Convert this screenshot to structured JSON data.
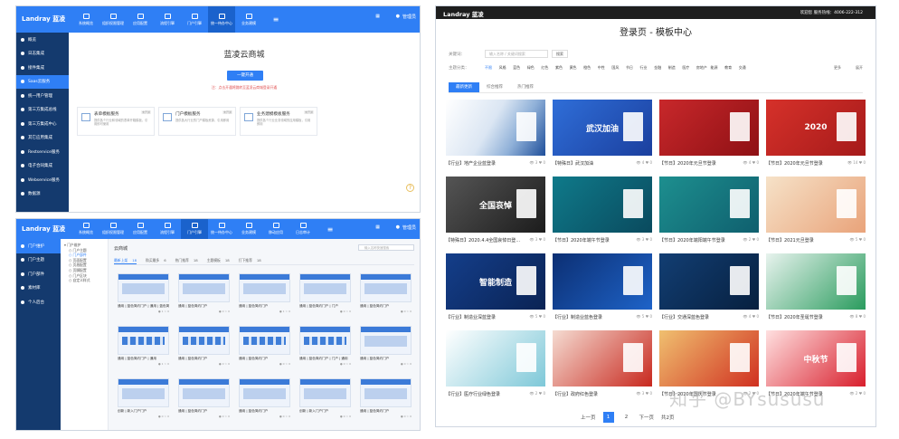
{
  "colors": {
    "primary": "#2f7ff5",
    "sidebar": "#143a6e",
    "dark_bar": "#1e1e1e"
  },
  "pane1": {
    "brand": "Landray 蓝凌",
    "nav": [
      {
        "label": "系统概览",
        "icon": "monitor-icon"
      },
      {
        "label": "组织权限管理",
        "icon": "grid-icon"
      },
      {
        "label": "应用配置",
        "icon": "apps-icon"
      },
      {
        "label": "流程引擎",
        "icon": "gear-icon"
      },
      {
        "label": "门户引擎",
        "icon": "home-icon"
      },
      {
        "label": "统一待办中心",
        "icon": "layers-icon"
      },
      {
        "label": "业务建模",
        "icon": "model-icon"
      }
    ],
    "nav_active": 5,
    "user": "管理员",
    "sidebar": [
      "概览",
      "日志集成",
      "接件集成",
      "Saas云服务",
      "统一用户管理",
      "第三方集成总线",
      "第三方集成中心",
      "其它应用集成",
      "Restservice服务",
      "电子合同集成",
      "Webservice服务",
      "数据源"
    ],
    "sidebar_active": 3,
    "store_title": "蓝凌云商城",
    "activate": "一键开通",
    "note": "注：点击开通将跳转至蓝凌云商城登录开通",
    "cards": [
      {
        "name": "表单模板服务",
        "desc": "提供各个行业和领域的表单开箱模板，引用即可使用",
        "badge": "未开通"
      },
      {
        "name": "门户模板服务",
        "desc": "提供各大行业的门户模板资源，引用即用",
        "badge": "未开通"
      },
      {
        "name": "业务建模模板服务",
        "desc": "提供各个行业业务领域的应用模板，引用即用",
        "badge": "未开通"
      }
    ]
  },
  "pane2": {
    "brand": "Landray 蓝凌",
    "nav": [
      {
        "label": "系统概览",
        "icon": "monitor-icon"
      },
      {
        "label": "组织权限管理",
        "icon": "grid-icon"
      },
      {
        "label": "应用配置",
        "icon": "apps-icon"
      },
      {
        "label": "流程引擎",
        "icon": "gear-icon"
      },
      {
        "label": "门户引擎",
        "icon": "home-icon"
      },
      {
        "label": "统一待办中心",
        "icon": "layers-icon"
      },
      {
        "label": "业务建模",
        "icon": "model-icon"
      },
      {
        "label": "移动应用",
        "icon": "mobile-icon"
      },
      {
        "label": "日志审计",
        "icon": "eye-icon"
      }
    ],
    "nav_active": 4,
    "user": "管理员",
    "sidebar": [
      "门户维护",
      "门户主题",
      "门户部件",
      "素材库",
      "个人后台"
    ],
    "sidebar_active": 0,
    "tree": [
      "门户维护",
      "门户主题",
      "门户部件",
      "页面配置",
      "页眉配置",
      "页脚配置",
      "门户区块",
      "自定义样式"
    ],
    "tree_selected": 2,
    "title": "云商城",
    "search_placeholder": "输入名称快速搜索",
    "tabs": [
      {
        "label": "最新上架",
        "count": "18",
        "active": true
      },
      {
        "label": "购买最多",
        "count": "6"
      },
      {
        "label": "热门推荐",
        "count": "18"
      },
      {
        "label": "主题模板",
        "count": "18"
      },
      {
        "label": "打下推荐",
        "count": "18"
      }
    ],
    "templates": [
      {
        "caption": "通用 | 蓝色简约门户 | 通用 | 蓝色简约门户",
        "stats": "● 1 ☆ 0"
      },
      {
        "caption": "通用 | 蓝色简约门户",
        "stats": "● 0 ☆ 0"
      },
      {
        "caption": "通用 | 蓝色简约门户",
        "stats": "● 1 ☆ 0"
      },
      {
        "caption": "通用 | 蓝色简约门户 | 门户",
        "stats": "● 0 ☆ 0"
      },
      {
        "caption": "通用 | 蓝色简约门户",
        "stats": "● 0 ☆ 0"
      },
      {
        "caption": "通用 | 蓝色简约门户 | 通用",
        "stats": "● 1 ☆ 0"
      },
      {
        "caption": "通用 | 蓝色简约门户",
        "stats": "● 0 ☆ 0"
      },
      {
        "caption": "通用 | 蓝色简约门户",
        "stats": "● 0 ☆ 0"
      },
      {
        "caption": "通用 | 蓝色简约门户 | 门户 | 通用",
        "stats": "● 0 ☆ 0"
      },
      {
        "caption": "通用 | 蓝色简约门户",
        "stats": "● 0 ☆ 0"
      },
      {
        "caption": "创新 | 新入门户门户",
        "stats": "● 0 ☆ 0"
      },
      {
        "caption": "通用 | 蓝色简约门户",
        "stats": "● 0 ☆ 0"
      },
      {
        "caption": "通用 | 蓝色简约门户",
        "stats": "● 0 ☆ 0"
      },
      {
        "caption": "创新 | 新入门户门户",
        "stats": "● 0 ☆ 0"
      },
      {
        "caption": "通用 | 蓝色简约门户",
        "stats": "● 0 ☆ 0"
      }
    ]
  },
  "pane3": {
    "brand": "Landray 蓝凌",
    "phone": "欢迎您  服务热线：4006-222-312",
    "title": "登录页 - 模板中心",
    "filter1_label": "关键词：",
    "search_placeholder": "输入名称 / 关键词搜索",
    "search_btn": "搜索",
    "filter2_label": "主题分类：",
    "chips": [
      "不限",
      "风格",
      "蓝色",
      "绿色",
      "红色",
      "紫色",
      "黄色",
      "橙色",
      "中性",
      "国风",
      "节日",
      "行业",
      "金融",
      "制造",
      "医疗",
      "房地产",
      "能源",
      "教育",
      "交通"
    ],
    "chips_active": 0,
    "right1": "更多",
    "right2": "展开",
    "tabs": [
      "最新更新",
      "综合推荐",
      "热门推荐"
    ],
    "tabs_active": 0,
    "templates": [
      {
        "title": "【行业】地产企业蓝登录",
        "views": "👁 3 ♥ 0",
        "art": "",
        "bg": "linear-gradient(120deg,#ffffff 0%,#dbe6f3 45%,#8fb0d8 70%,#1f4f9a 100%)"
      },
      {
        "title": "【特殊日】武汉加油",
        "views": "👁 4 ♥ 0",
        "art": "武汉加油",
        "bg": "linear-gradient(135deg,#2f6ed8,#1b3f9e)"
      },
      {
        "title": "【节日】2020年元旦节登录",
        "views": "👁 4 ♥ 0",
        "art": "",
        "bg": "linear-gradient(135deg,#c8282b,#8e1014)"
      },
      {
        "title": "【节日】2020年元旦节登录",
        "views": "👁 14 ♥ 0",
        "art": "2020",
        "bg": "linear-gradient(135deg,#d6312a,#a51a1a)"
      },
      {
        "title": "【特殊日】2020.4.4全国哀悼日登...",
        "views": "👁 3 ♥ 0",
        "art": "全国哀悼",
        "bg": "linear-gradient(135deg,#555,#1c1c1c)"
      },
      {
        "title": "【节日】2020年端午节登录",
        "views": "👁 3 ♥ 0",
        "art": "",
        "bg": "linear-gradient(135deg,#0f7a8a,#0a4a5e)"
      },
      {
        "title": "【节日】2020年端阳端午节登录",
        "views": "👁 2 ♥ 0",
        "art": "",
        "bg": "linear-gradient(135deg,#1d8f8f,#0f5f6e)"
      },
      {
        "title": "【节日】2021元旦登录",
        "views": "👁 5 ♥ 0",
        "art": "",
        "bg": "linear-gradient(135deg,#f6e2c8,#e9a37a)"
      },
      {
        "title": "【行业】制造业深蓝登录",
        "views": "👁 5 ♥ 0",
        "art": "智能制造",
        "bg": "linear-gradient(135deg,#143e8a,#0a2354)"
      },
      {
        "title": "【行业】制造业蓝色登录",
        "views": "👁 5 ♥ 0",
        "art": "",
        "bg": "linear-gradient(135deg,#0c2f73,#1e63c8)"
      },
      {
        "title": "【行业】交通深蓝色登录",
        "views": "👁 4 ♥ 0",
        "art": "",
        "bg": "linear-gradient(135deg,#123e73,#07203f)"
      },
      {
        "title": "【节日】2020年圣诞节登录",
        "views": "👁 8 ♥ 0",
        "art": "",
        "bg": "linear-gradient(135deg,#e8f3ee,#2a9c5e)"
      },
      {
        "title": "【行业】医疗行业绿色登录",
        "views": "👁 2 ♥ 0",
        "art": "",
        "bg": "linear-gradient(135deg,#ffffff,#7ec8d8)"
      },
      {
        "title": "【行业】政府红色登录",
        "views": "👁 3 ♥ 0",
        "art": "",
        "bg": "linear-gradient(135deg,#f5dcd2,#c8281e)"
      },
      {
        "title": "【节日】2020年国庆节登录",
        "views": "👁 2 ♥ 0",
        "art": "",
        "bg": "linear-gradient(135deg,#f0c070,#d03020)"
      },
      {
        "title": "【节日】2020年端午节登录",
        "views": "👁 2 ♥ 0",
        "art": "中秋节",
        "bg": "linear-gradient(135deg,#ffe0e0,#d81e2c)"
      }
    ],
    "pager": {
      "prev": "上一页",
      "pages": [
        "1",
        "2"
      ],
      "active": 0,
      "next": "下一页",
      "tail": "共2页"
    }
  },
  "watermark": "知乎 @BYsususu"
}
